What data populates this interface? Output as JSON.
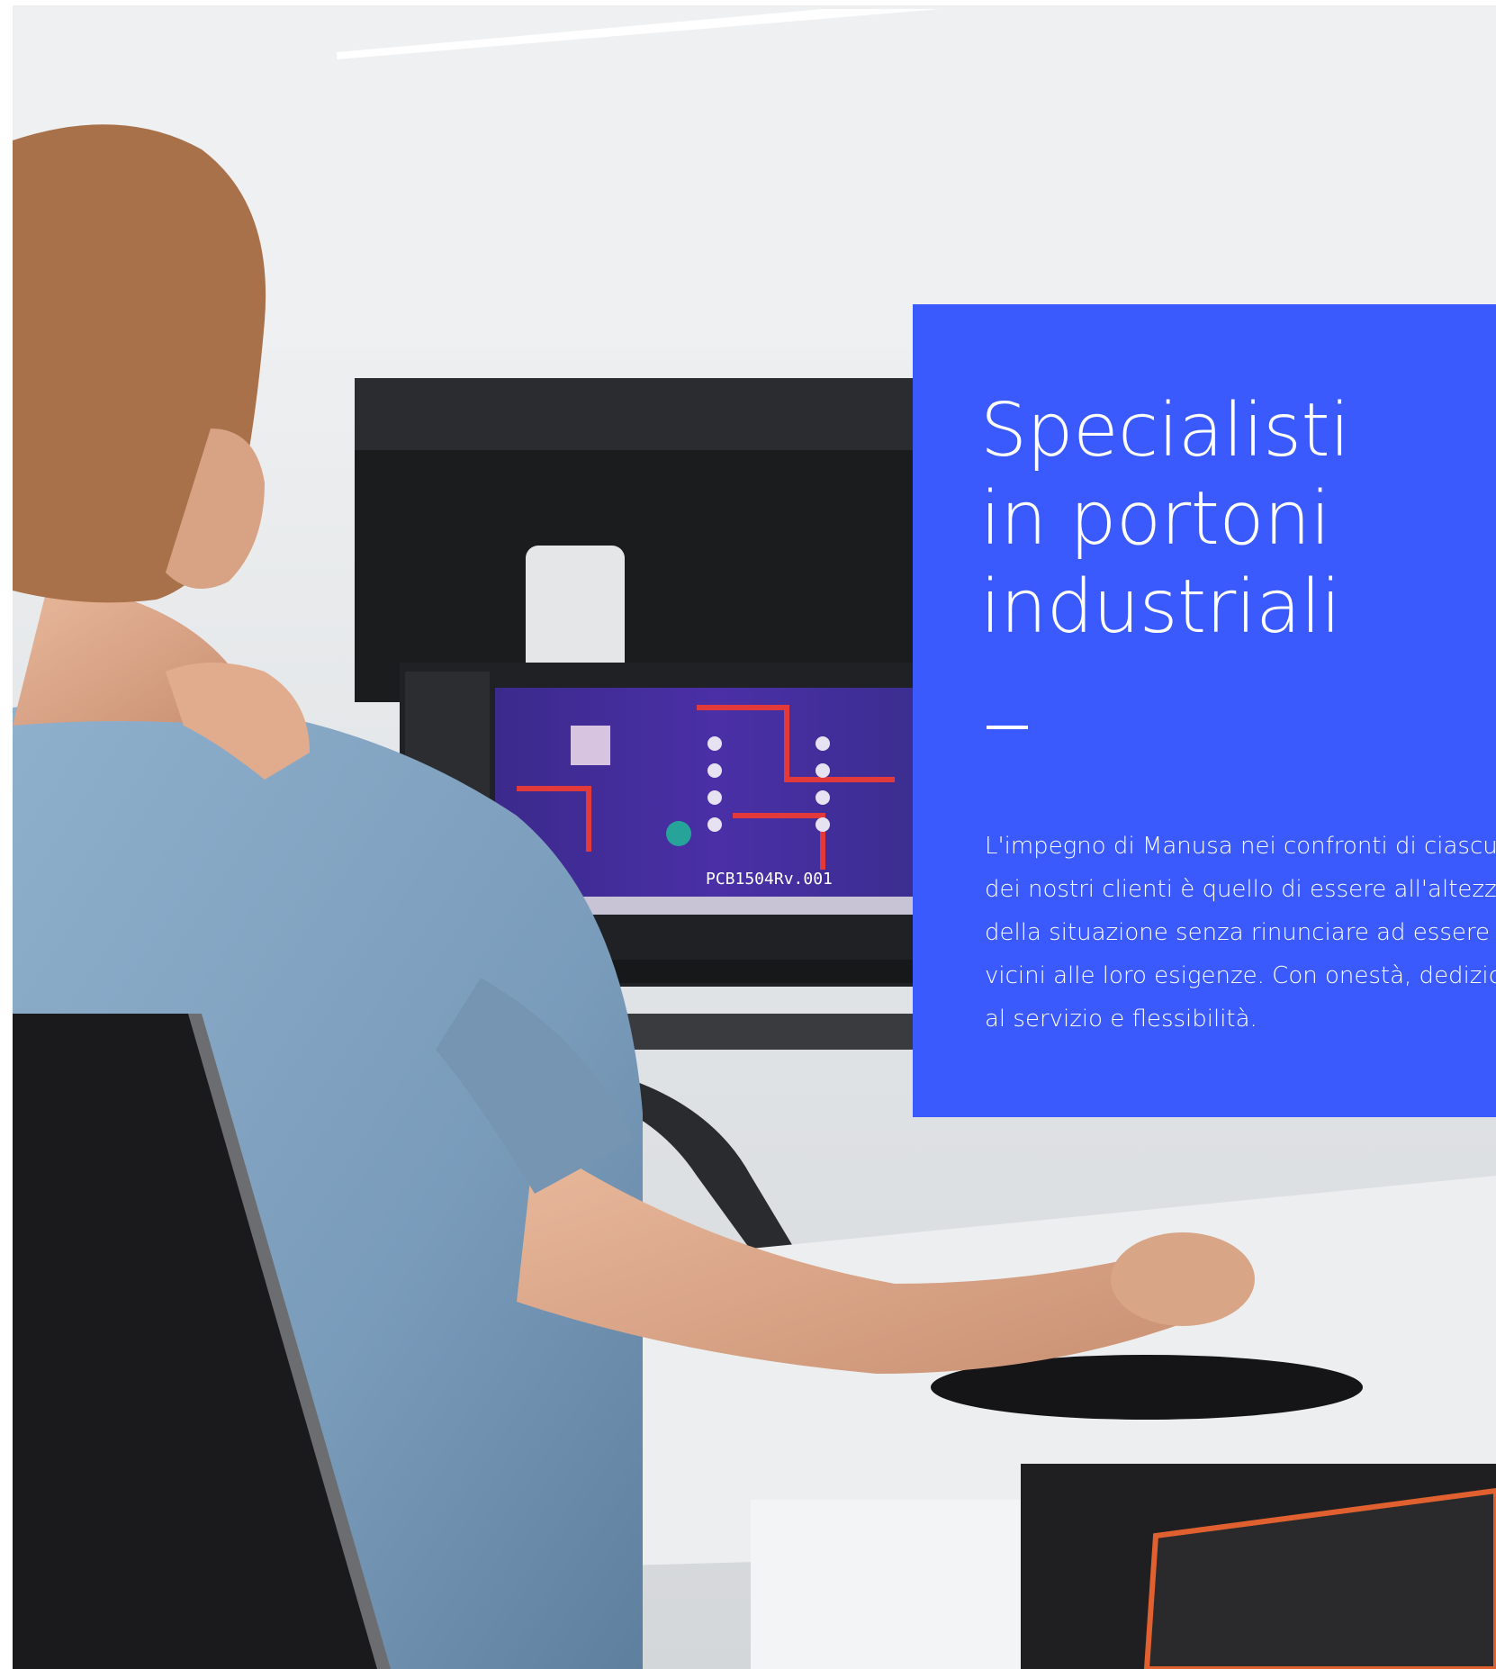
{
  "hero": {
    "title": "Specialisti\nin portoni\nindustriali",
    "body": "L'impegno di Manusa nei confronti di ciascuno\ndei nostri clienti è quello di essere all'altezza\ndella situazione senza rinunciare ad essere\nvicini alle loro esigenze. Con onestà, dedizione\nal servizio e flessibilità.",
    "accent_color": "#3a5afe"
  },
  "photo": {
    "screen_label": "PCB1504Rv.001"
  }
}
